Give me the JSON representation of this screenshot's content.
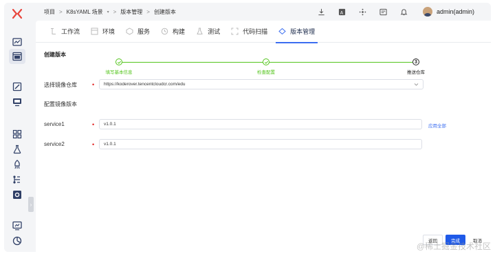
{
  "breadcrumb": {
    "items": [
      "项目",
      "K8sYAML 场景",
      "版本管理",
      "创建版本"
    ]
  },
  "user": {
    "name": "admin(admin)"
  },
  "tabs": [
    {
      "label": "工作流",
      "icon": "workflow-icon"
    },
    {
      "label": "环境",
      "icon": "environment-icon"
    },
    {
      "label": "服务",
      "icon": "service-icon"
    },
    {
      "label": "构建",
      "icon": "build-icon"
    },
    {
      "label": "测试",
      "icon": "test-icon"
    },
    {
      "label": "代码扫描",
      "icon": "code-scan-icon"
    },
    {
      "label": "版本管理",
      "icon": "version-icon",
      "active": true
    }
  ],
  "page": {
    "title": "创建版本"
  },
  "steps": [
    {
      "label": "填写基本信息",
      "status": "done"
    },
    {
      "label": "检查配置",
      "status": "done"
    },
    {
      "label": "推送仓库",
      "status": "current",
      "number": "3"
    }
  ],
  "form": {
    "registry_label": "选择镜像仓库",
    "registry_value": "https://koderover.tencentcloudcr.com/edu",
    "config_label": "配置镜像版本",
    "services": [
      {
        "name": "service1",
        "version": "v1.0.1"
      },
      {
        "name": "service2",
        "version": "v1.0.1"
      }
    ],
    "apply_all": "应用全部"
  },
  "footer": {
    "back": "返回",
    "done": "完成",
    "cancel": "取消"
  },
  "watermark": "@稀土掘金技术社区",
  "colors": {
    "accent": "#1f5ae8",
    "success": "#52c41a",
    "required": "#e02020"
  }
}
